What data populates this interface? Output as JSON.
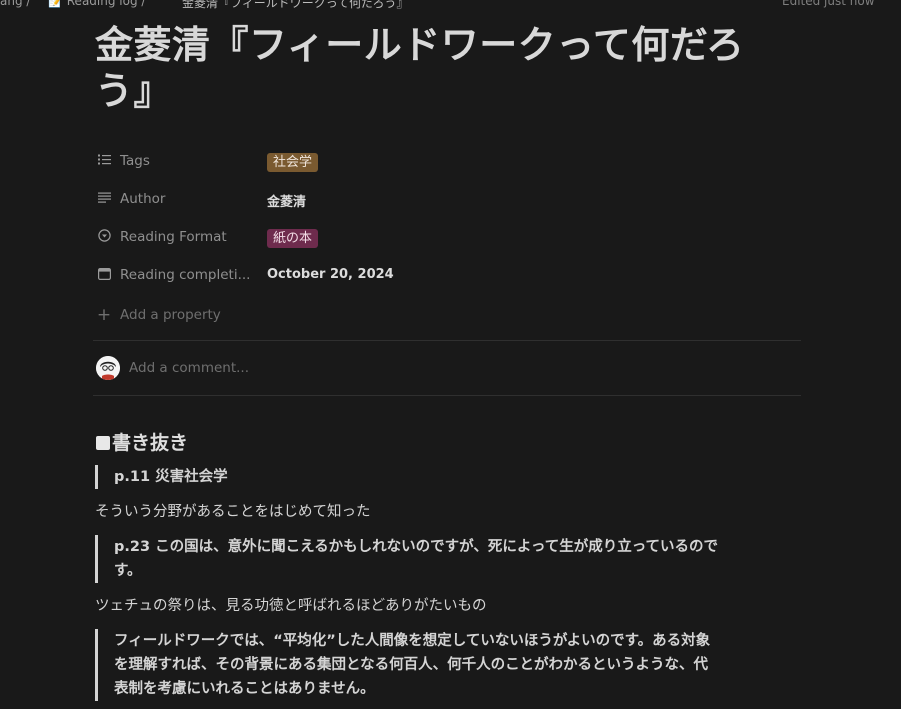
{
  "topbar": {
    "crumb_left": "ang /",
    "crumb_mid": "📝 Reading log /",
    "crumb_right": "金菱清『フィールドワークって何だろう』",
    "edited": "Edited just now"
  },
  "page": {
    "title": "金菱清『フィールドワークって何だろう』"
  },
  "properties": [
    {
      "icon": "list-icon",
      "name": "Tags",
      "value": "社会学",
      "type": "tag",
      "color": "#7a5a30"
    },
    {
      "icon": "text-lines-icon",
      "name": "Author",
      "value": "金菱清",
      "type": "text"
    },
    {
      "icon": "select-circle-icon",
      "name": "Reading Format",
      "value": "紙の本",
      "type": "tag",
      "color": "#6e2b4d"
    },
    {
      "icon": "calendar-icon",
      "name": "Reading completi...",
      "value": "October 20, 2024",
      "type": "text"
    }
  ],
  "add_property_label": "Add a property",
  "comment_placeholder": "Add a comment...",
  "section_heading": "書き抜き",
  "blocks": {
    "quote1": "p.11 災害社会学",
    "para1": "そういう分野があることをはじめて知った",
    "quote2_line1": "p.23 この国は、意外に聞こえるかもしれないのですが、死によって生が成り立っているので",
    "quote2_line2": "す。",
    "para2": "ツェチュの祭りは、見る功徳と呼ばれるほどありがたいもの",
    "quote3_line1": "フィールドワークでは、“平均化”した人間像を想定していないほうがよいのです。ある対象",
    "quote3_line2": "を理解すれば、その背景にある集団となる何百人、何千人のことがわかるというような、代",
    "quote3_line3": "表制を考慮にいれることはありません。"
  }
}
